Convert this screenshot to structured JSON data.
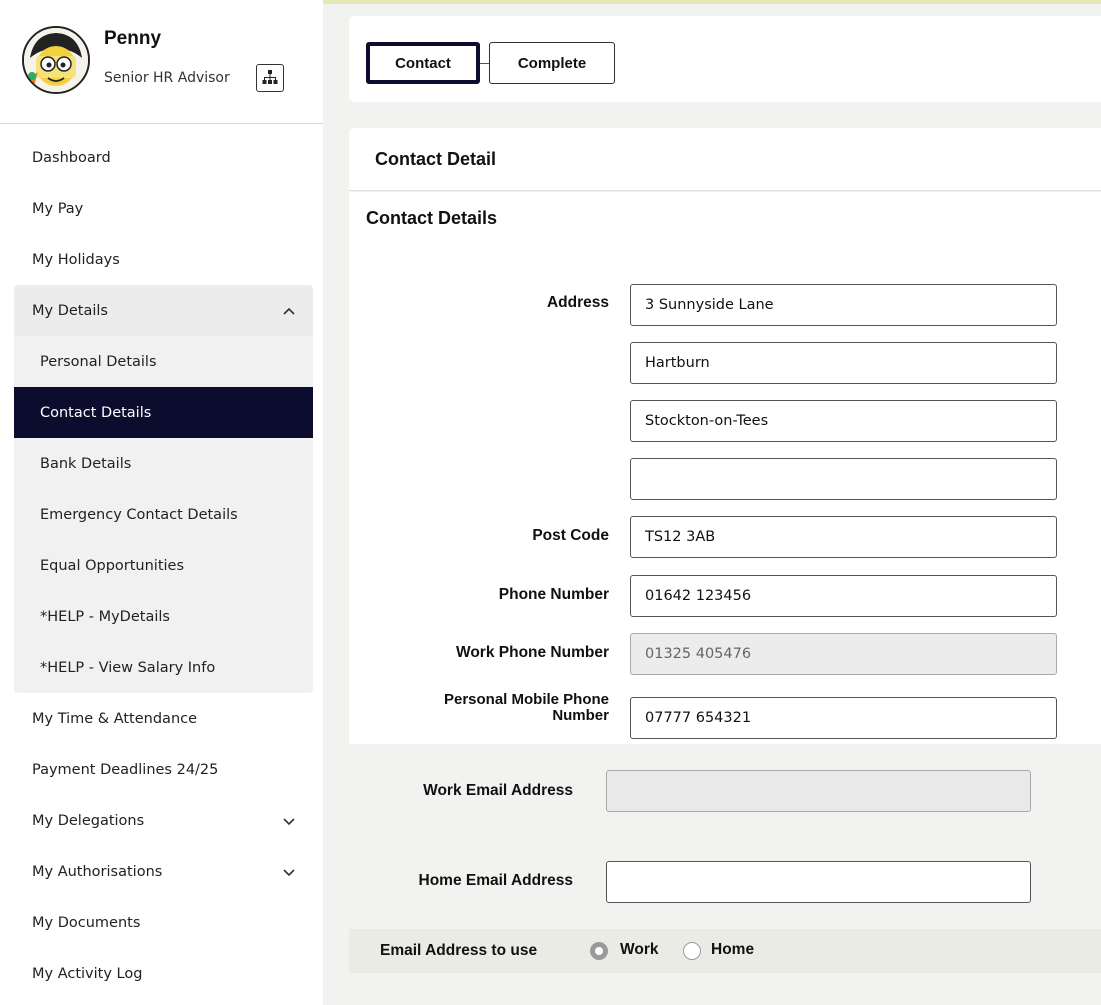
{
  "profile": {
    "name": "Penny",
    "role": "Senior HR Advisor"
  },
  "nav": {
    "dashboard": "Dashboard",
    "my_pay": "My Pay",
    "my_holidays": "My Holidays",
    "my_details": "My Details",
    "my_details_sub": {
      "personal": "Personal Details",
      "contact": "Contact Details",
      "bank": "Bank Details",
      "emergency": "Emergency Contact Details",
      "equal": "Equal Opportunities",
      "help_details": "*HELP - MyDetails",
      "help_salary": "*HELP - View Salary Info"
    },
    "time_attendance": "My Time & Attendance",
    "payment_deadlines": "Payment Deadlines 24/25",
    "delegations": "My Delegations",
    "authorisations": "My Authorisations",
    "documents": "My Documents",
    "activity_log": "My Activity Log"
  },
  "tabs": {
    "contact": "Contact",
    "complete": "Complete"
  },
  "detail": {
    "header": "Contact Detail",
    "section_title": "Contact Details"
  },
  "form": {
    "address_label": "Address",
    "address_line1": "3 Sunnyside Lane",
    "address_line2": "Hartburn",
    "address_line3": "Stockton-on-Tees",
    "address_line4": "",
    "postcode_label": "Post Code",
    "postcode": "TS12 3AB",
    "phone_label": "Phone Number",
    "phone": "01642 123456",
    "work_phone_label": "Work Phone Number",
    "work_phone": "01325 405476",
    "mobile_label_line1": "Personal Mobile Phone",
    "mobile_label_line2": "Number",
    "mobile": "07777 654321",
    "work_email_label": "Work Email Address",
    "work_email": "",
    "home_email_label": "Home Email Address",
    "home_email": "",
    "email_to_use_label": "Email Address to use",
    "email_option_work": "Work",
    "email_option_home": "Home"
  }
}
